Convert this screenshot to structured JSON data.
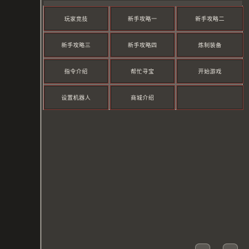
{
  "menu": {
    "items": [
      {
        "label": "玩家竞技"
      },
      {
        "label": "新手攻略一"
      },
      {
        "label": "新手攻略二"
      },
      {
        "label": "新手攻略三"
      },
      {
        "label": "新手攻略四"
      },
      {
        "label": "炼制装备"
      },
      {
        "label": "指令介绍"
      },
      {
        "label": "帮忙寻宝"
      },
      {
        "label": "开始游戏"
      },
      {
        "label": "设置机器人"
      },
      {
        "label": "商城介绍"
      },
      {
        "label": ""
      }
    ]
  }
}
